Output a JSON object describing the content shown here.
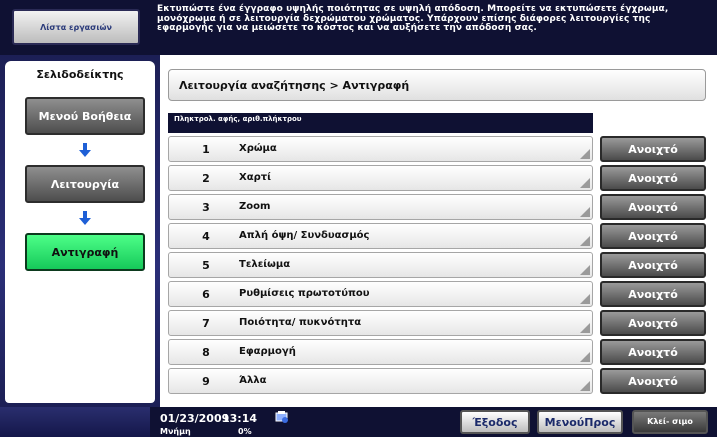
{
  "topbar": {
    "tools_label": "Λίστα εργασιών",
    "message": "Εκτυπώστε ένα έγγραφο υψηλής ποιότητας σε υψηλή απόδοση. Μπορείτε να εκτυπώσετε έγχρωμα, μονόχρωμα ή σε λειτουργία δεχρώματου χρώματος. Υπάρχουν επίσης διάφορες λειτουργίες της εφαρμογής για να μειώσετε το κόστος και να αυξήσετε την απόδοση σας."
  },
  "sidebar": {
    "bookmark_tab": "Σελιδοδείκτης",
    "items": [
      {
        "label": "Μενού Βοήθεια"
      },
      {
        "label": "Λειτουργία"
      },
      {
        "label": "Αντιγραφή"
      }
    ]
  },
  "main": {
    "breadcrumb": "Λειτουργία αναζήτησης > Αντιγραφή",
    "list_header": "Πληκτρολ. αφής, αριθ.πλήκτρου",
    "open_label": "Ανοιχτό",
    "rows": [
      {
        "num": "1",
        "name": "Χρώμα"
      },
      {
        "num": "2",
        "name": "Χαρτί"
      },
      {
        "num": "3",
        "name": "Zoom"
      },
      {
        "num": "4",
        "name": "Απλή όψη/ Συνδυασμός"
      },
      {
        "num": "5",
        "name": "Τελείωμα"
      },
      {
        "num": "6",
        "name": "Ρυθμίσεις πρωτοτύπου"
      },
      {
        "num": "7",
        "name": "Ποιότητα/ πυκνότητα"
      },
      {
        "num": "8",
        "name": "Εφαρμογή"
      },
      {
        "num": "9",
        "name": "Άλλα"
      }
    ]
  },
  "bottombar": {
    "date": "01/23/2009",
    "time": "13:14",
    "memory_label": "Μνήμη",
    "memory_value": "0%",
    "exit_label": "Έξοδος",
    "menu_label": "ΜενούΠρος",
    "close_label": "Κλεί- σιμο"
  },
  "colors": {
    "bar_navy": "#0f1133",
    "active_green": "#22d96a",
    "arrow_blue": "#1e5fd6"
  }
}
